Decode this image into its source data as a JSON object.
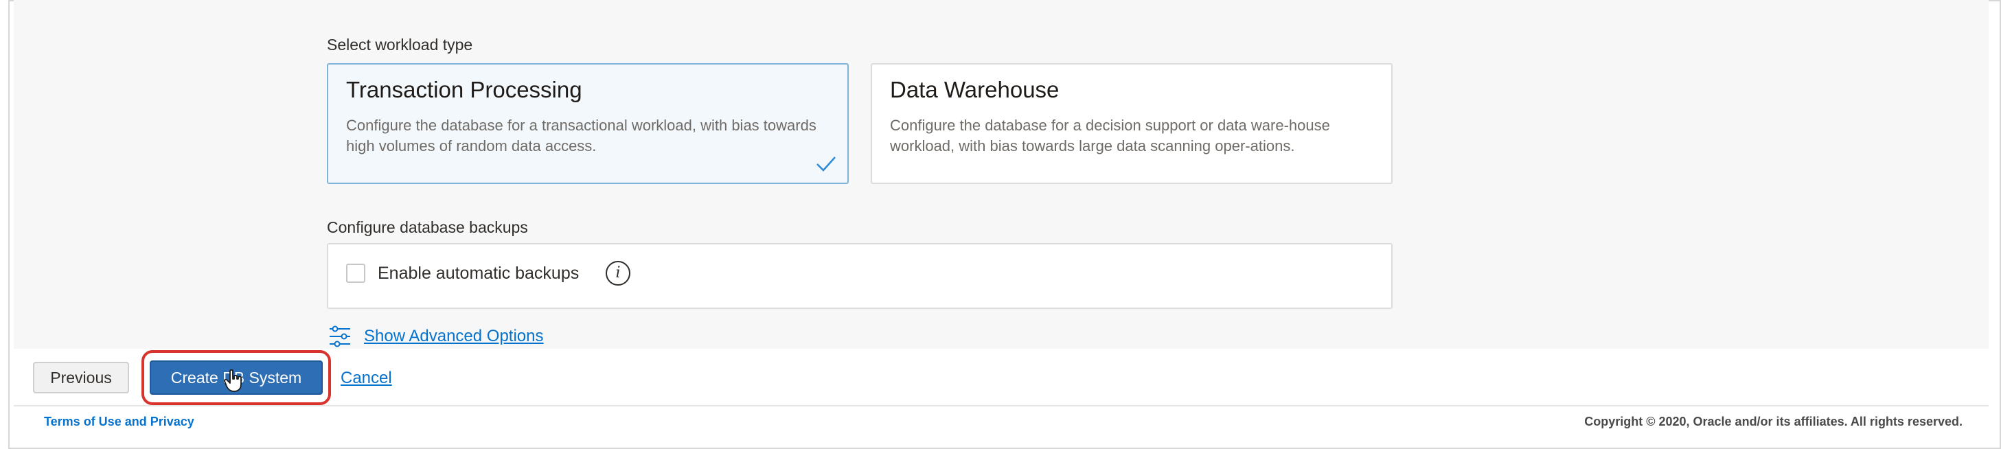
{
  "workload": {
    "label": "Select workload type",
    "options": [
      {
        "title": "Transaction Processing",
        "description": "Configure the database for a transactional workload, with bias towards high volumes of random data access.",
        "selected": true
      },
      {
        "title": "Data Warehouse",
        "description": "Configure the database for a decision support or data ware-house workload, with bias towards large data scanning oper-ations.",
        "selected": false
      }
    ]
  },
  "backups": {
    "label": "Configure database backups",
    "enable_label": "Enable automatic backups",
    "enabled": false,
    "info_icon": "i"
  },
  "advanced_link": "Show Advanced Options",
  "actions": {
    "previous": "Previous",
    "create": "Create DB System",
    "cancel": "Cancel"
  },
  "footer": {
    "terms": "Terms of Use and Privacy",
    "copyright": "Copyright © 2020, Oracle and/or its affiliates. All rights reserved."
  },
  "colors": {
    "primary_button": "#2d6eb5",
    "link": "#0572ce",
    "highlight": "#d9332d",
    "selected_card_border": "#7fb4d8"
  },
  "icons": [
    "check-icon",
    "info-icon",
    "sliders-icon",
    "hand-cursor-icon"
  ]
}
